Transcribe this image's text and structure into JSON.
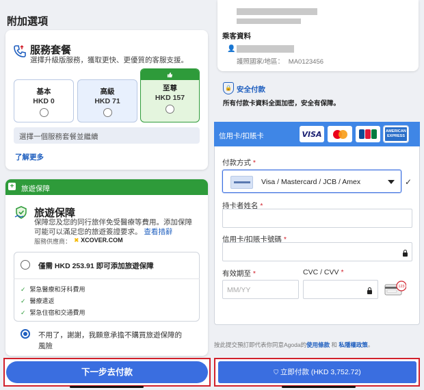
{
  "left": {
    "section_title": "附加選項",
    "service": {
      "title": "服務套餐",
      "description": "選擇升級版服務，獲取更快、更優質的客服支援。",
      "tiers": [
        {
          "name": "基本",
          "price": "HKD 0"
        },
        {
          "name": "高級",
          "price": "HKD 71"
        },
        {
          "name": "至尊",
          "price": "HKD 157"
        }
      ],
      "hint": "選擇一個服務套餐並繼續",
      "learn_more": "了解更多"
    },
    "insurance": {
      "header": "旅遊保障",
      "title": "旅遊保障",
      "description_1": "保障您及您的同行旅伴免受醫療等費用。添加保障",
      "description_2": "可能可以滿足您的旅遊簽證要求。",
      "view_details": "查看措辭",
      "provider_label": "服務供應商：",
      "provider_name": "XCOVER.COM",
      "add_option": "僅需 HKD 253.91 即可添加旅遊保障",
      "benefits": [
        "緊急醫療和牙科費用",
        "醫療遣返",
        "緊急住宿和交通費用"
      ],
      "decline_option": "不用了，謝謝，我願意承擔不購買旅遊保障的風險"
    },
    "next_button": "下一步去付款"
  },
  "right": {
    "passenger": {
      "title": "乘客資料",
      "nationality_label": "護照國家/地區：",
      "passport_no": "MA0123456"
    },
    "secure": {
      "title": "安全付款",
      "description": "所有付款卡資料全面加密，安全有保障。"
    },
    "payment": {
      "header": "信用卡/扣賬卡",
      "brands": [
        "VISA",
        "Mastercard",
        "JCB",
        "AMERICAN EXPRESS"
      ],
      "method_label": "付款方式",
      "method_value": "Visa / Mastercard / JCB / Amex",
      "cardholder_label": "持卡者姓名",
      "card_number_label": "信用卡/扣賬卡號碼",
      "expiry_label": "有效期至",
      "expiry_placeholder": "MM/YY",
      "cvc_label": "CVC / CVV",
      "cvc_badge": "123",
      "required_mark": "*"
    },
    "terms": {
      "prefix": "按此提交預訂即代表你同意Agoda的",
      "terms_link": "使用條款",
      "and": " 和 ",
      "privacy_link": "私隱權政策",
      "suffix": "。"
    },
    "pay_button": "立即付款 (HKD 3,752.72)"
  }
}
